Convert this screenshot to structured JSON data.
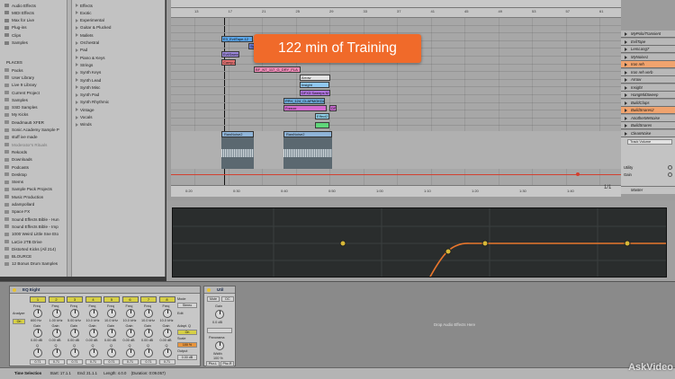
{
  "browser": {
    "places_top": [
      "Audio Effects",
      "MIDI Effects",
      "Max for Live",
      "Plug-ins",
      "Clips",
      "Samples"
    ],
    "places_header": "PLACES",
    "places": [
      "Packs",
      "User Library",
      "Live 9 Library",
      "Current Project",
      "Samples",
      "SSD Samples",
      "My Kicks",
      "Deadmau5 XFER",
      "Sonic Academy Sample P",
      "stuff ive made",
      "Moderator's Rituals",
      "Rekords",
      "Downloads",
      "Podcasts",
      "Desktop",
      "Stems",
      "Sample Pack Projects",
      "Music Production",
      "adampollard",
      "Space FX",
      "Sound Effects Bible - Hun",
      "Sound Effects Bible - Imp",
      "1000 Weird Little Sne Eto",
      "LaCie 2TB Drive",
      "Distorted Kicks (All 214)",
      "BLOURCE",
      "12 Bonus Drum Samples"
    ],
    "content": [
      "Effects",
      "Exotic",
      "Experimental",
      "Guitar & Plucked",
      "Mallets",
      "Orchestral",
      "Pad",
      "Piano & Keys",
      "Strings",
      "Synth Keys",
      "Synth Lead",
      "Synth Misc",
      "Synth Pad",
      "Synth Rhythmic",
      "Vintage",
      "Vocals",
      "Winds"
    ]
  },
  "banner": {
    "text": "122 min of Training"
  },
  "arrangement": {
    "bar_labels": [
      "13",
      "17",
      "21",
      "25",
      "29",
      "33",
      "37",
      "41",
      "45",
      "49",
      "53",
      "57",
      "61"
    ],
    "time_labels": [
      "0:20",
      "0:30",
      "0:40",
      "0:50",
      "1:00",
      "1:10",
      "1:20",
      "1:30",
      "1:40"
    ],
    "page_indicator": "1/1",
    "clips": [
      "E3_EvilTape-12",
      "Swell.2",
      "EvilSweep",
      "Camp.d",
      "BF_NT_117_G_DRY_FLA",
      "Arrow",
      "Insight",
      "DFX3 Sweeps M",
      "PPH_124_CLAPMOKDA",
      "Freeze",
      "DFX3",
      "Effect2"
    ],
    "audio_clips": [
      "RawNoise2",
      "RawNoise2"
    ],
    "tracks": [
      {
        "name": "MyPolo/Transient",
        "selected": false
      },
      {
        "name": "EvilTape",
        "selected": false
      },
      {
        "name": "LemLong7",
        "selected": false
      },
      {
        "name": "MyNoise1",
        "selected": false
      },
      {
        "name": "Iron reh",
        "selected": true
      },
      {
        "name": "Iron reh verb",
        "selected": false
      },
      {
        "name": "Arrow",
        "selected": false
      },
      {
        "name": "Insight",
        "selected": false
      },
      {
        "name": "HangMidSweep",
        "selected": false
      },
      {
        "name": "BuildClaps",
        "selected": false
      },
      {
        "name": "BuildSnares2",
        "selected": true
      },
      {
        "name": "AnotherMeNoise",
        "selected": false
      },
      {
        "name": "BuildSnares",
        "selected": false
      },
      {
        "name": "CleanNoise",
        "selected": false
      }
    ],
    "track_panel": {
      "device": "Track Volume",
      "utility": "Utility",
      "gain": "Gain"
    },
    "master": "Master"
  },
  "devices": {
    "eq_title": "EQ Eight",
    "eq_analyze": "Analyze",
    "eq_adapt_q": "Adapt. Q",
    "eq_on": "On",
    "eq_mode": "Mode",
    "eq_mode_value": "Stereo",
    "eq_edit": "Edit",
    "eq_scale": "Scale",
    "eq_scale_value": "100 %",
    "eq_output": "Output",
    "eq_output_value": "0.00 dB",
    "bands": [
      {
        "num": "1",
        "freq": "600 Hz",
        "gain": "0.00 dB",
        "q": "0.71"
      },
      {
        "num": "2",
        "freq": "1.00 kHz",
        "gain": "0.00 dB",
        "q": "0.71"
      },
      {
        "num": "3",
        "freq": "5.00 kHz",
        "gain": "0.00 dB",
        "q": "0.71"
      },
      {
        "num": "4",
        "freq": "10.0 kHz",
        "gain": "0.00 dB",
        "q": "0.71"
      },
      {
        "num": "5",
        "freq": "10.0 kHz",
        "gain": "0.00 dB",
        "q": "0.71"
      },
      {
        "num": "6",
        "freq": "10.0 kHz",
        "gain": "0.00 dB",
        "q": "0.71"
      },
      {
        "num": "7",
        "freq": "10.0 kHz",
        "gain": "0.00 dB",
        "q": "0.71"
      },
      {
        "num": "8",
        "freq": "10.0 kHz",
        "gain": "0.00 dB",
        "q": "0.71"
      }
    ],
    "freq_label": "Freq",
    "gain_label": "Gain",
    "q_label": "Q",
    "util_title": "Util",
    "util_gain": "Gain",
    "util_gain_value": "0.0 dB",
    "util_mono": "Mute",
    "util_dc": "DC",
    "util_panorama": "Panorama",
    "util_width": "Width",
    "util_width_value": "100 %",
    "util_phz_l": "Phz-L",
    "util_phz_r": "Phz-R",
    "drop_text": "Drop Audio Effects Here"
  },
  "status": {
    "label": "Time Selection",
    "start": "Start: 17.1.1",
    "end": "End: 21.1.1",
    "length": "Length: 4.0.0",
    "duration": "(Duration: 0:09.057)"
  },
  "watermark": {
    "text": "AskVideo"
  },
  "colors": {
    "banner": "#f06a2a",
    "selected_track": "#f0a36e",
    "curve": "#e8762c",
    "band_point": "#d8b838"
  }
}
